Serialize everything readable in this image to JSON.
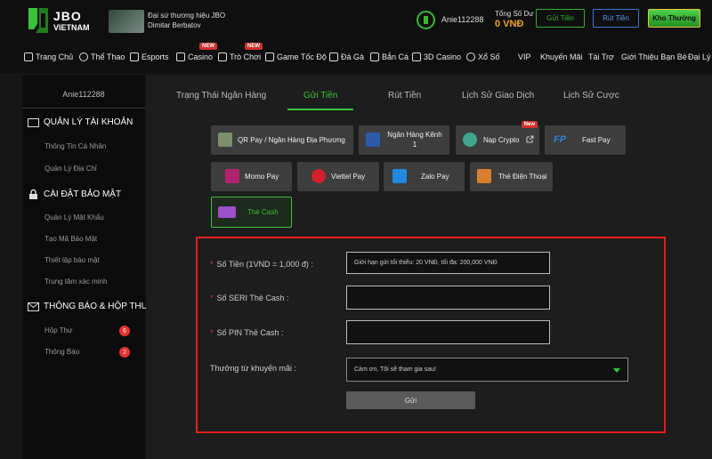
{
  "brand": {
    "name_line1": "JBO",
    "name_line2": "VIETNAM",
    "accent": "#39c436"
  },
  "ambassador": {
    "line1": "Đại sứ thương hiệu JBO",
    "line2": "Dimitar Berbatov"
  },
  "user": {
    "name": "Anie112288"
  },
  "balance": {
    "label": "Tổng Số Dư",
    "value": "0 VNĐ"
  },
  "header_buttons": {
    "deposit": "Gửi Tiền",
    "withdraw": "Rút Tiền",
    "treasure": "Kho Thưởng"
  },
  "nav": [
    {
      "label": "Trang Chủ",
      "icon": "home-icon"
    },
    {
      "label": "Thể Thao",
      "icon": "soccer-ball-icon"
    },
    {
      "label": "Esports",
      "icon": "gamepad-icon"
    },
    {
      "label": "Casino",
      "icon": "cards-icon",
      "badge": "NEW"
    },
    {
      "label": "Trò Chơi",
      "icon": "slot-machine-icon",
      "badge": "NEW"
    },
    {
      "label": "Game Tốc Độ",
      "icon": "speed-controller-icon"
    },
    {
      "label": "Đá Gà",
      "icon": "rooster-icon"
    },
    {
      "label": "Bắn Cá",
      "icon": "fish-icon"
    },
    {
      "label": "3D Casino",
      "icon": "3d-cube-icon"
    },
    {
      "label": "Xổ Số",
      "icon": "lottery-icon"
    },
    {
      "label": "VIP"
    },
    {
      "label": "Khuyến Mãi"
    },
    {
      "label": "Tài Trợ"
    },
    {
      "label": "Giới Thiệu Bạn Bè"
    },
    {
      "label": "Đại Lý"
    }
  ],
  "sidebar": {
    "username": "Anie112288",
    "sections": [
      {
        "title": "QUẢN LÝ TÀI KHOẢN",
        "icon": "id-card-icon",
        "items": [
          "Thông Tin Cá Nhân",
          "Quản Lý Địa Chỉ"
        ]
      },
      {
        "title": "CÀI ĐẶT BẢO MẬT",
        "icon": "lock-icon",
        "items": [
          "Quản Lý Mật Khẩu",
          "Tạo Mã Bảo Mật",
          "Thiết lập bảo mật",
          "Trung tâm xác minh"
        ]
      },
      {
        "title": "THÔNG BÁO & HỘP THƯ",
        "icon": "envelope-icon",
        "items": [
          {
            "label": "Hộp Thư",
            "count": "6"
          },
          {
            "label": "Thông Báo",
            "count": "2"
          }
        ]
      }
    ]
  },
  "tabs": [
    "Trạng Thái Ngân Hàng",
    "Gửi Tiền",
    "Rút Tiền",
    "Lịch Sử Giao Dịch",
    "Lịch Sử Cược"
  ],
  "active_tab": "Gửi Tiền",
  "payment_methods": [
    {
      "label": "QR Pay / Ngân Hàng Địa Phương",
      "icon": "qr-code-icon"
    },
    {
      "label": "Ngân Hàng Kênh 1",
      "icon": "bank-icon"
    },
    {
      "label": "Nạp Crypto",
      "icon": "tether-icon",
      "badge": "New",
      "trailing_icon": "external-link-icon"
    },
    {
      "label": "Fast Pay",
      "icon": "fastpay-icon"
    },
    {
      "label": "Momo Pay",
      "icon": "momo-icon"
    },
    {
      "label": "Viettel Pay",
      "icon": "viettel-icon"
    },
    {
      "label": "Zalo Pay",
      "icon": "zalopay-icon"
    },
    {
      "label": "Thẻ Điện Thoại",
      "icon": "phone-card-icon"
    },
    {
      "label": "Thẻ Cash",
      "icon": "cash-card-icon",
      "selected": true
    }
  ],
  "form": {
    "amount_label": "Số Tiền (1VND = 1,000 đ) :",
    "amount_placeholder": "Giới hạn gửi tối thiểu: 20 VNĐ, tối đa: 200,000 VNĐ",
    "serial_label": "Số SERI Thẻ Cash :",
    "pin_label": "Số PIN Thẻ Cash :",
    "promo_label": "Thưởng từ khuyến mãi :",
    "promo_value": "Cảm ơn, Tôi sẽ tham gia sau!",
    "submit_label": "Gửi"
  }
}
